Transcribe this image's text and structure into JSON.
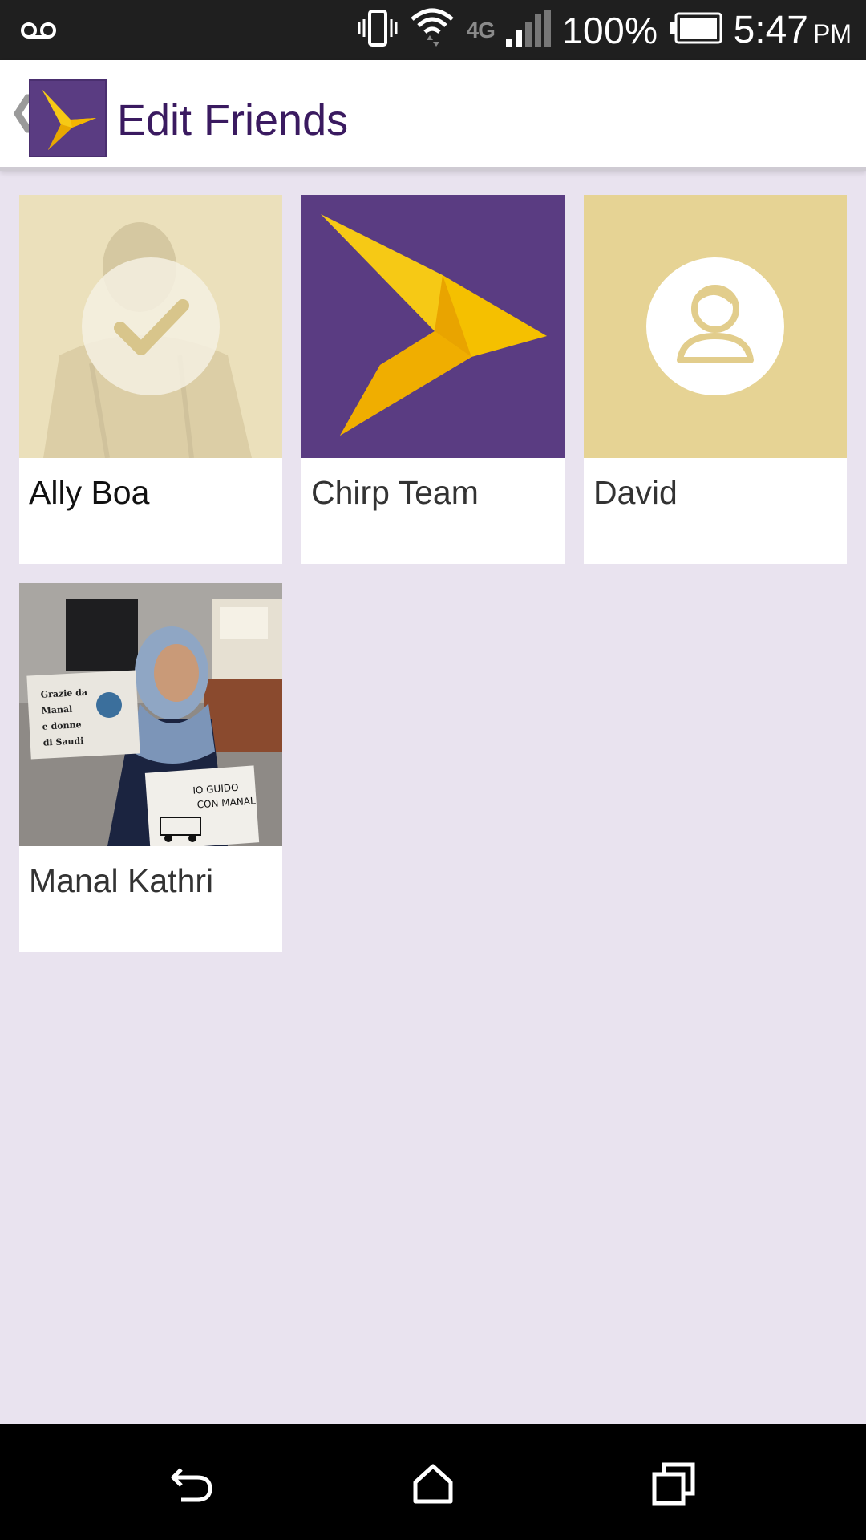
{
  "status_bar": {
    "battery_percent": "100%",
    "time": "5:47",
    "ampm": "PM",
    "network_label": "4G",
    "icons": [
      "voicemail-icon",
      "vibrate-icon",
      "wifi-icon",
      "signal-icon",
      "battery-icon"
    ]
  },
  "app_bar": {
    "title": "Edit Friends",
    "icons": [
      "back-chevron-icon",
      "chirp-bird-icon"
    ]
  },
  "friends": [
    {
      "name": "Ally Boa",
      "selected": true,
      "avatar": "photo"
    },
    {
      "name": "Chirp Team",
      "selected": false,
      "avatar": "chirp-bird-icon"
    },
    {
      "name": "David",
      "selected": false,
      "avatar": "person-placeholder-icon"
    },
    {
      "name": "Manal Kathri",
      "selected": false,
      "avatar": "photo"
    }
  ],
  "photo_text": {
    "sign_left": "Grazie da Manal e donne di Saudi",
    "sign_right": "IO GUIDO CON MANAL"
  },
  "nav_bar": {
    "icons": [
      "back-icon",
      "home-icon",
      "recent-apps-icon"
    ]
  },
  "colors": {
    "brand_purple": "#5a3c82",
    "brand_yellow": "#f6c915",
    "background": "#e9e3ef",
    "placeholder_tan": "#e6d394"
  }
}
